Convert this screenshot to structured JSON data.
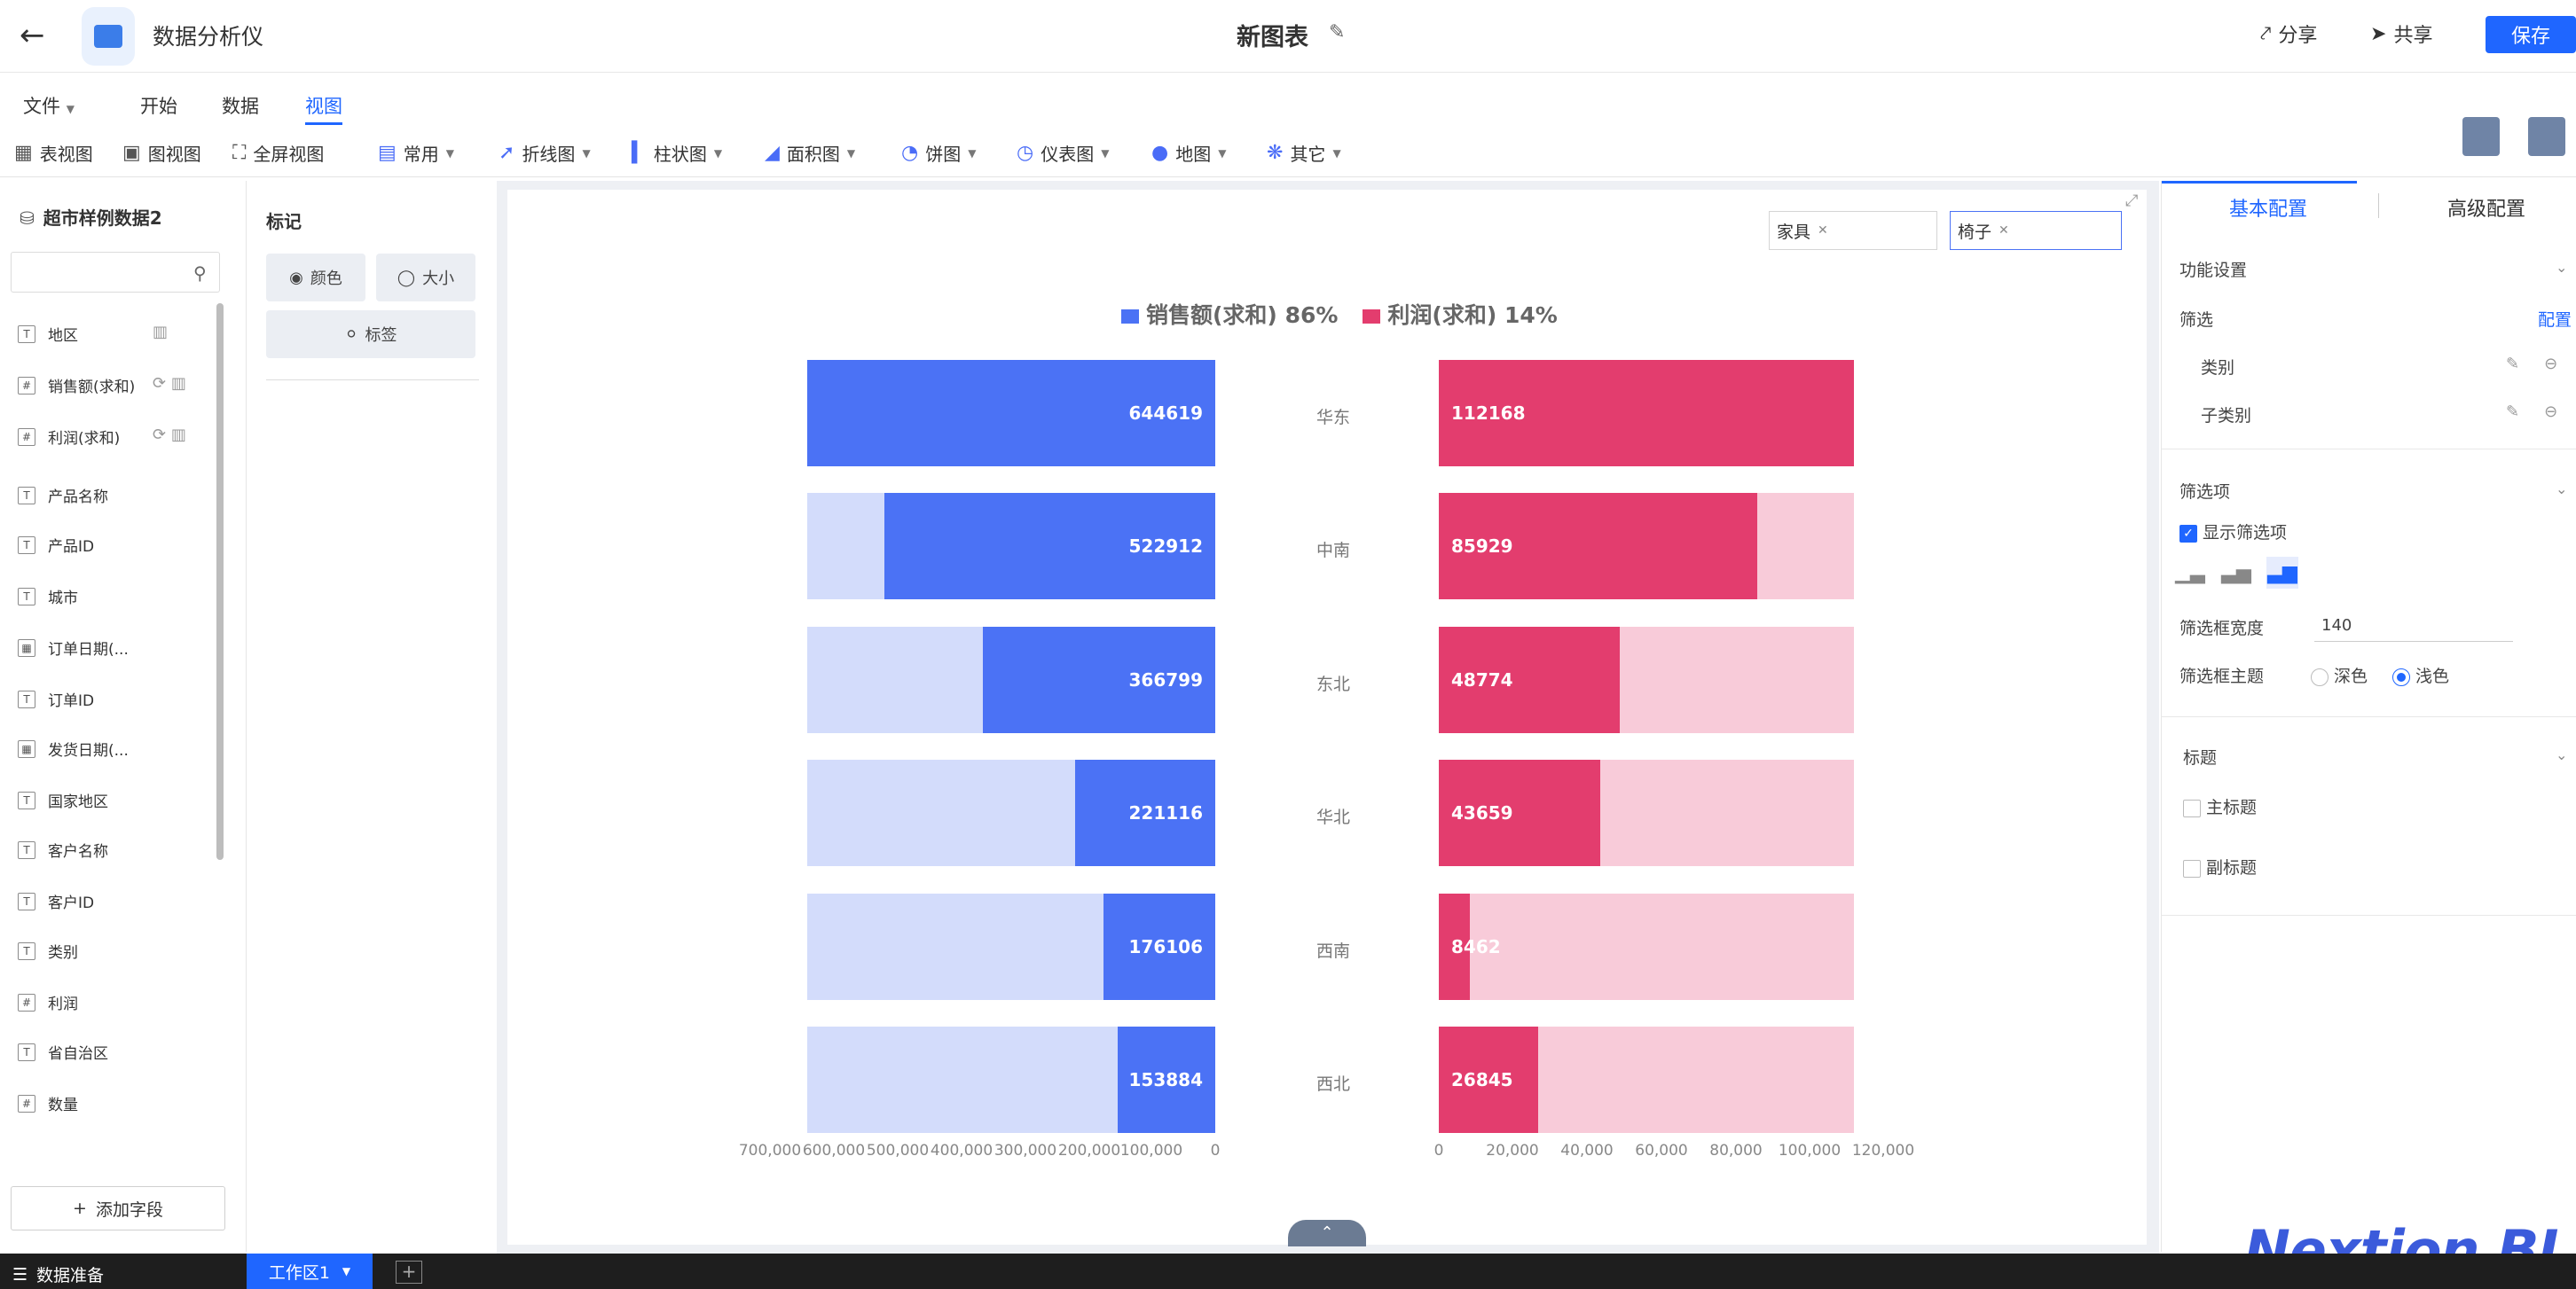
{
  "header": {
    "back_icon": "arrow-left-icon",
    "app_name": "数据分析仪",
    "doc_title": "新图表",
    "share": "分享",
    "collab": "共享",
    "save": "保存"
  },
  "menus": [
    "文件",
    "开始",
    "数据",
    "视图"
  ],
  "active_menu": "视图",
  "toolbar": {
    "table_view": "表视图",
    "chart_view": "图视图",
    "fullscreen": "全屏视图",
    "common": "常用",
    "line": "折线图",
    "bar": "柱状图",
    "area": "面积图",
    "pie": "饼图",
    "gauge": "仪表图",
    "map": "地图",
    "other": "其它"
  },
  "left_panel": {
    "dataset": "超市样例数据2",
    "search_placeholder": "",
    "fields": [
      {
        "name": "地区",
        "type": "T"
      },
      {
        "name": "销售额(求和)",
        "type": "123"
      },
      {
        "name": "利润(求和)",
        "type": "123"
      },
      {
        "name": "产品名称",
        "type": "T"
      },
      {
        "name": "产品ID",
        "type": "T"
      },
      {
        "name": "城市",
        "type": "T"
      },
      {
        "name": "订单日期(...",
        "type": "date"
      },
      {
        "name": "订单ID",
        "type": "T"
      },
      {
        "name": "发货日期(...",
        "type": "date"
      },
      {
        "name": "国家地区",
        "type": "T"
      },
      {
        "name": "客户名称",
        "type": "T"
      },
      {
        "name": "客户ID",
        "type": "T"
      },
      {
        "name": "类别",
        "type": "T"
      },
      {
        "name": "利润",
        "type": "123"
      },
      {
        "name": "省自治区",
        "type": "T"
      },
      {
        "name": "数量",
        "type": "123"
      }
    ],
    "add_field": "添加字段"
  },
  "mark_panel": {
    "title": "标记",
    "color": "颜色",
    "size": "大小",
    "label": "标签"
  },
  "filters": {
    "chip1": "家具",
    "chip2": "椅子"
  },
  "chart_data": {
    "type": "bar",
    "layout": "butterfly",
    "categories": [
      "华东",
      "中南",
      "东北",
      "华北",
      "西南",
      "西北"
    ],
    "series": [
      {
        "name": "销售额(求和)",
        "share": "86%",
        "values": [
          644619,
          522912,
          366799,
          221116,
          176106,
          153884
        ],
        "color": "#4b72f5",
        "bg_color": "#d3dcfb"
      },
      {
        "name": "利润(求和)",
        "share": "14%",
        "values": [
          112168,
          85929,
          48774,
          43659,
          8462,
          26845
        ],
        "color": "#e33d6e",
        "bg_color": "#f8cbd9"
      }
    ],
    "left_axis_ticks": [
      "700,000",
      "600,000",
      "500,000",
      "400,000",
      "300,000",
      "200,000",
      "100,000",
      "0"
    ],
    "right_axis_ticks": [
      "0",
      "20,000",
      "40,000",
      "60,000",
      "80,000",
      "100,000",
      "120,000"
    ],
    "left_max": 644619,
    "right_max": 112168,
    "legend_position": "top"
  },
  "right_panel": {
    "tab_basic": "基本配置",
    "tab_advanced": "高级配置",
    "feature_settings": "功能设置",
    "filter": "筛选",
    "config": "配置",
    "filter_items": [
      "类别",
      "子类别"
    ],
    "filter_options": "筛选项",
    "show_filter": "显示筛选项",
    "filter_width_label": "筛选框宽度",
    "filter_width_value": "140",
    "filter_theme_label": "筛选框主题",
    "theme_dark": "深色",
    "theme_light": "浅色",
    "title_section": "标题",
    "main_title": "主标题",
    "sub_title": "副标题"
  },
  "watermark": "Nextion BI",
  "bottom": {
    "data_prep": "数据准备",
    "workspace": "工作区1"
  }
}
